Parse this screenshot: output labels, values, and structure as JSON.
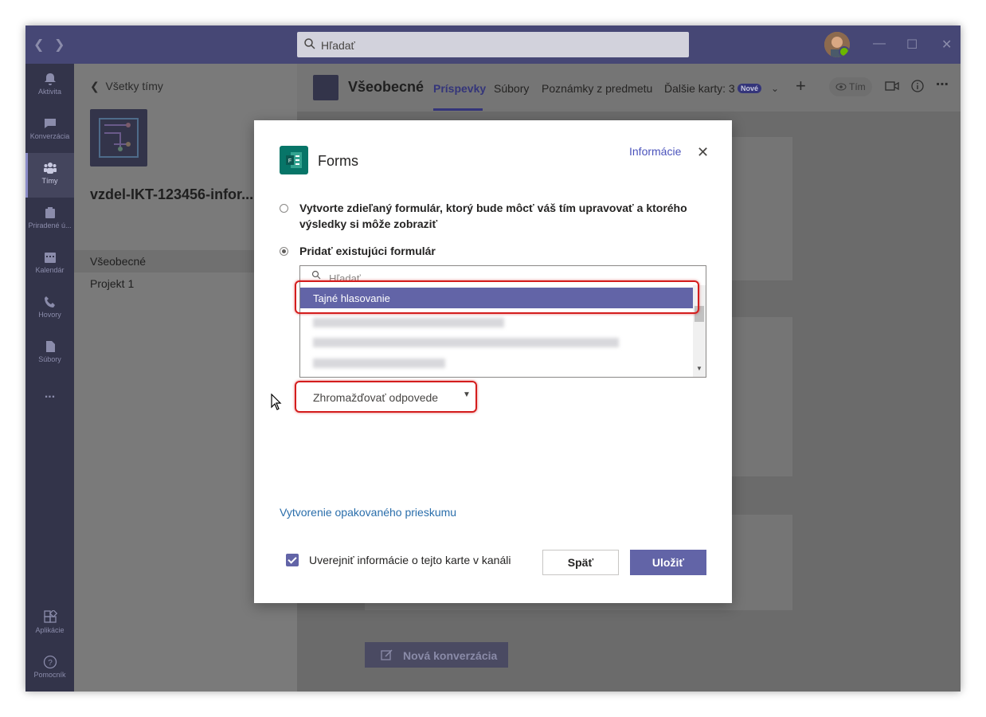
{
  "titlebar": {
    "search_placeholder": "Hľadať"
  },
  "rail": {
    "items": [
      {
        "label": "Aktivita",
        "icon": "bell-icon"
      },
      {
        "label": "Konverzácia",
        "icon": "chat-icon"
      },
      {
        "label": "Tímy",
        "icon": "teams-icon"
      },
      {
        "label": "Priradené ú...",
        "icon": "assignments-icon"
      },
      {
        "label": "Kalendár",
        "icon": "calendar-icon"
      },
      {
        "label": "Hovory",
        "icon": "phone-icon"
      },
      {
        "label": "Súbory",
        "icon": "file-icon"
      },
      {
        "label": "...",
        "icon": "more-icon"
      }
    ],
    "apps_label": "Aplikácie",
    "help_label": "Pomocník"
  },
  "sidebar": {
    "back_label": "Všetky tímy",
    "team_name": "vzdel-IKT-123456-infor...",
    "channels": [
      "Všeobecné",
      "Projekt 1"
    ]
  },
  "header": {
    "channel_title": "Všeobecné",
    "tabs": [
      "Príspevky",
      "Súbory",
      "Poznámky z predmetu",
      "Ďalšie karty: 3"
    ],
    "new_badge": "Nové",
    "team_pill": "Tím"
  },
  "main": {
    "new_conversation_label": "Nová konverzácia"
  },
  "dialog": {
    "title": "Forms",
    "info_link": "Informácie",
    "option_create": "Vytvorte zdieľaný formulár, ktorý bude môcť váš tím upravovať a ktorého výsledky si môže zobraziť",
    "option_existing": "Pridať existujúci formulár",
    "list_search_placeholder": "Hľadať",
    "selected_form": "Tajné hlasovanie",
    "dropdown_value": "Zhromažďovať odpovede",
    "repeat_link": "Vytvorenie opakovaného prieskumu",
    "publish_label": "Uverejniť informácie o tejto karte v kanáli",
    "back_button": "Späť",
    "save_button": "Uložiť"
  },
  "colors": {
    "accent": "#6264a7",
    "titlebar": "#464775",
    "rail": "#33344a",
    "highlight": "#d41d1d",
    "forms_brand": "#077568"
  }
}
